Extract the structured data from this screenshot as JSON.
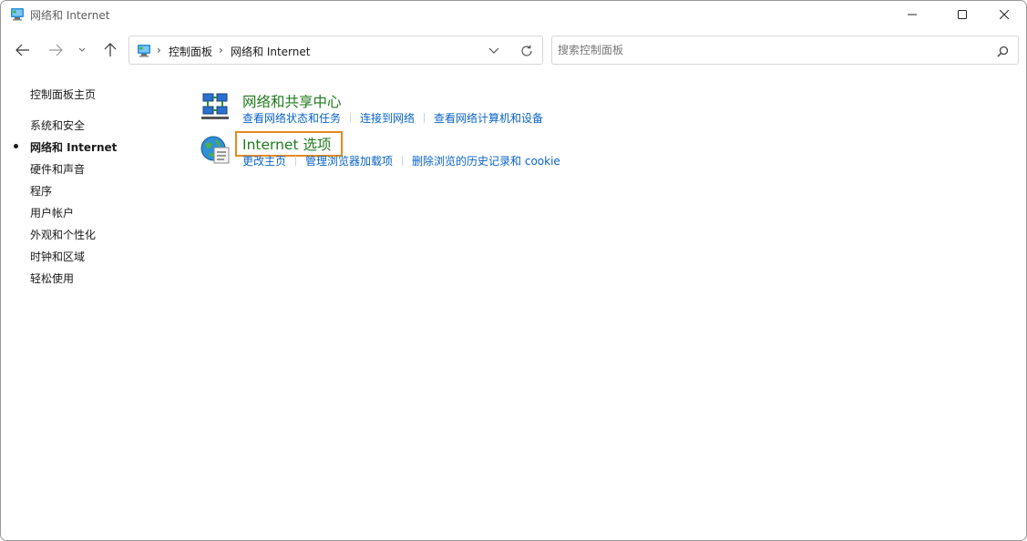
{
  "window": {
    "title": "网络和 Internet"
  },
  "address_bar": {
    "breadcrumbs": [
      "控制面板",
      "网络和 Internet"
    ]
  },
  "search": {
    "placeholder": "搜索控制面板",
    "value": ""
  },
  "sidebar": {
    "home": "控制面板主页",
    "items": [
      {
        "label": "系统和安全",
        "active": false
      },
      {
        "label": "网络和 Internet",
        "active": true
      },
      {
        "label": "硬件和声音",
        "active": false
      },
      {
        "label": "程序",
        "active": false
      },
      {
        "label": "用户帐户",
        "active": false
      },
      {
        "label": "外观和个性化",
        "active": false
      },
      {
        "label": "时钟和区域",
        "active": false
      },
      {
        "label": "轻松使用",
        "active": false
      }
    ]
  },
  "categories": [
    {
      "title": "网络和共享中心",
      "icon": "network-sharing-icon",
      "links": [
        "查看网络状态和任务",
        "连接到网络",
        "查看网络计算机和设备"
      ]
    },
    {
      "title": "Internet 选项",
      "icon": "internet-options-icon",
      "highlighted": true,
      "links": [
        "更改主页",
        "管理浏览器加载项",
        "删除浏览的历史记录和 cookie"
      ]
    }
  ],
  "colors": {
    "category_title": "#1e7a1e",
    "link": "#0a63c9",
    "highlight_outline": "#e58a1f"
  }
}
